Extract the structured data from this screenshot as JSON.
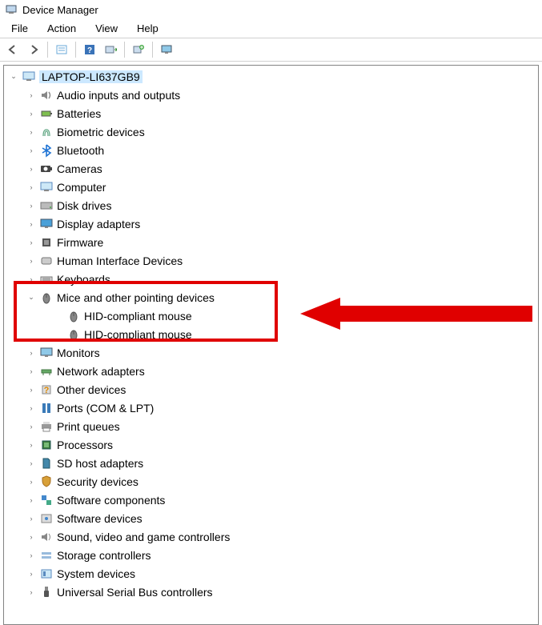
{
  "window": {
    "title": "Device Manager"
  },
  "menu": {
    "file": "File",
    "action": "Action",
    "view": "View",
    "help": "Help"
  },
  "toolbar": {
    "back": "back-icon",
    "forward": "forward-icon",
    "props": "properties-icon",
    "help": "help-icon",
    "scan": "scan-icon",
    "add": "add-hardware-icon",
    "monitor": "monitor-icon"
  },
  "root": {
    "label": "LAPTOP-LI637GB9"
  },
  "categories": [
    {
      "icon": "audio-icon",
      "label": "Audio inputs and outputs"
    },
    {
      "icon": "battery-icon",
      "label": "Batteries"
    },
    {
      "icon": "biometric-icon",
      "label": "Biometric devices"
    },
    {
      "icon": "bluetooth-icon",
      "label": "Bluetooth"
    },
    {
      "icon": "camera-icon",
      "label": "Cameras"
    },
    {
      "icon": "computer-icon",
      "label": "Computer"
    },
    {
      "icon": "disk-icon",
      "label": "Disk drives"
    },
    {
      "icon": "display-icon",
      "label": "Display adapters"
    },
    {
      "icon": "firmware-icon",
      "label": "Firmware"
    },
    {
      "icon": "hid-icon",
      "label": "Human Interface Devices"
    },
    {
      "icon": "keyboard-icon",
      "label": "Keyboards"
    },
    {
      "icon": "mouse-icon",
      "label": "Mice and other pointing devices",
      "expanded": true,
      "children": [
        {
          "icon": "mouse-icon",
          "label": "HID-compliant mouse"
        },
        {
          "icon": "mouse-icon",
          "label": "HID-compliant mouse"
        }
      ]
    },
    {
      "icon": "monitor-icon",
      "label": "Monitors"
    },
    {
      "icon": "network-icon",
      "label": "Network adapters"
    },
    {
      "icon": "other-icon",
      "label": "Other devices"
    },
    {
      "icon": "ports-icon",
      "label": "Ports (COM & LPT)"
    },
    {
      "icon": "printer-icon",
      "label": "Print queues"
    },
    {
      "icon": "cpu-icon",
      "label": "Processors"
    },
    {
      "icon": "sd-icon",
      "label": "SD host adapters"
    },
    {
      "icon": "security-icon",
      "label": "Security devices"
    },
    {
      "icon": "software-comp-icon",
      "label": "Software components"
    },
    {
      "icon": "software-dev-icon",
      "label": "Software devices"
    },
    {
      "icon": "sound-icon",
      "label": "Sound, video and game controllers"
    },
    {
      "icon": "storage-icon",
      "label": "Storage controllers"
    },
    {
      "icon": "system-icon",
      "label": "System devices"
    },
    {
      "icon": "usb-icon",
      "label": "Universal Serial Bus controllers"
    }
  ],
  "annotation": {
    "highlight_color": "#e00000"
  }
}
